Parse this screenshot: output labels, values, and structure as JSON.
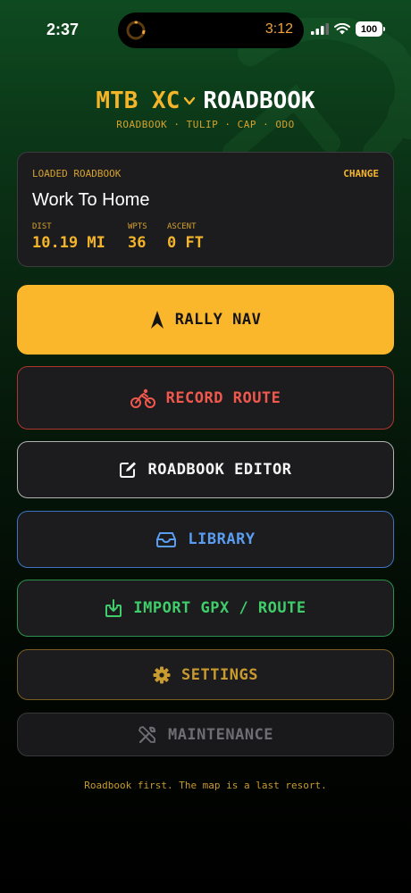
{
  "status_bar": {
    "time": "2:37",
    "timer": "3:12",
    "battery": "100",
    "icons": [
      "timer-ring-icon",
      "signal-icon",
      "wifi-icon",
      "battery-icon"
    ]
  },
  "header": {
    "mode": "MTB XC",
    "app_name": "ROADBOOK",
    "subtitle": "ROADBOOK · TULIP · CAP · ODO"
  },
  "loaded_roadbook": {
    "label": "LOADED ROADBOOK",
    "change_label": "CHANGE",
    "route_name": "Work To Home",
    "stats": [
      {
        "label": "DIST",
        "value": "10.19 MI"
      },
      {
        "label": "WPTS",
        "value": "36"
      },
      {
        "label": "ASCENT",
        "value": "0 FT"
      }
    ]
  },
  "menu": {
    "rally_nav": "RALLY NAV",
    "record_route": "RECORD ROUTE",
    "roadbook_editor": "ROADBOOK EDITOR",
    "library": "LIBRARY",
    "import": "IMPORT GPX / ROUTE",
    "settings": "SETTINGS",
    "maintenance": "MAINTENANCE"
  },
  "footer": "Roadbook first. The map is a last resort.",
  "colors": {
    "accent": "#fbb72c",
    "record": "#f0584d",
    "library": "#5a9cf0",
    "import": "#3fce6a",
    "settings": "#c99a2e",
    "disabled": "#6e6e72"
  }
}
